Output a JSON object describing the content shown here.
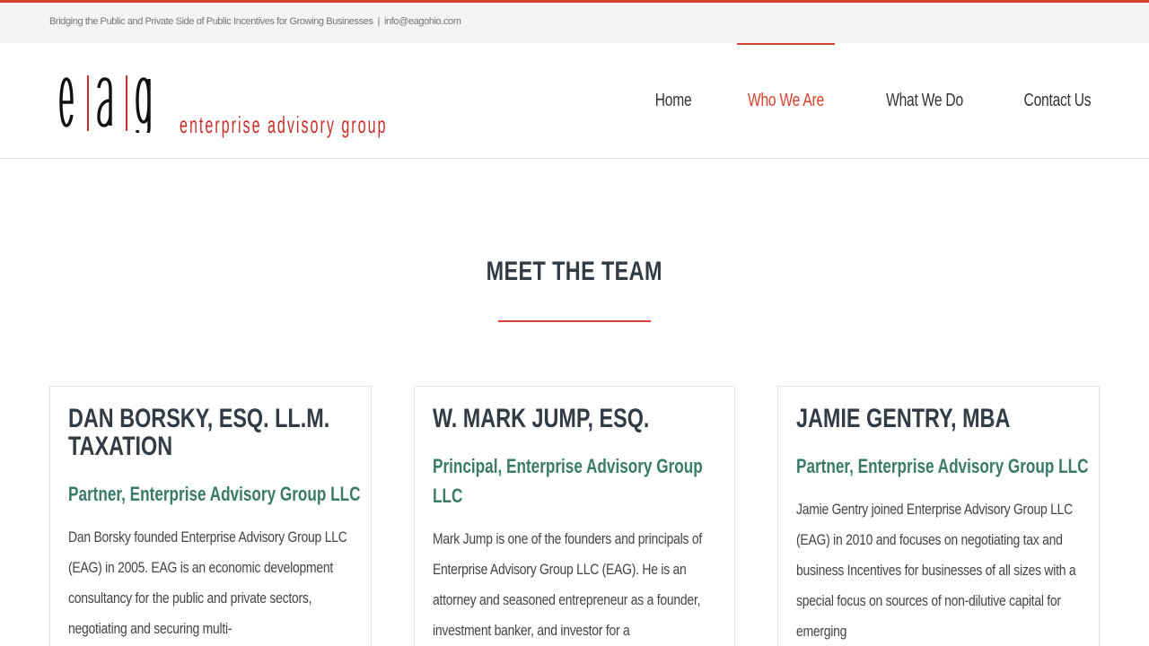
{
  "topbar": {
    "tagline": "Bridging the Public and Private Side of Public Incentives for Growing Businesses",
    "separator": "|",
    "email": "info@eagohio.com"
  },
  "logo": {
    "mark": "e|a|g",
    "name": "enterprise advisory group"
  },
  "nav": {
    "items": [
      {
        "label": "Home",
        "active": false
      },
      {
        "label": "Who We Are",
        "active": true
      },
      {
        "label": "What We Do",
        "active": false
      },
      {
        "label": "Contact Us",
        "active": false
      }
    ]
  },
  "section": {
    "title": "MEET THE TEAM"
  },
  "team": [
    {
      "name": "DAN BORSKY, ESQ. LL.M. TAXATION",
      "role": "Partner, Enterprise Advisory Group LLC",
      "bio": "Dan Borsky founded Enterprise Advisory Group LLC (EAG) in 2005. EAG is an economic development consultancy for the public and private sectors, negotiating and securing multi-"
    },
    {
      "name": "W. MARK JUMP, ESQ.",
      "role": "Principal, Enterprise Advisory Group LLC",
      "bio": "Mark Jump is one of the founders and principals of Enterprise Advisory Group LLC (EAG). He is an attorney and seasoned entrepreneur as a founder, investment banker, and investor for a"
    },
    {
      "name": "JAMIE GENTRY, MBA",
      "role": "Partner, Enterprise Advisory Group LLC",
      "bio": "Jamie Gentry joined Enterprise Advisory Group LLC (EAG) in 2010 and focuses on negotiating tax and business Incentives for businesses of all sizes with a special focus on sources of non-dilutive capital for emerging"
    }
  ],
  "colors": {
    "accent": "#d9402b",
    "role_green": "#3a7a68",
    "heading": "#333b45"
  }
}
